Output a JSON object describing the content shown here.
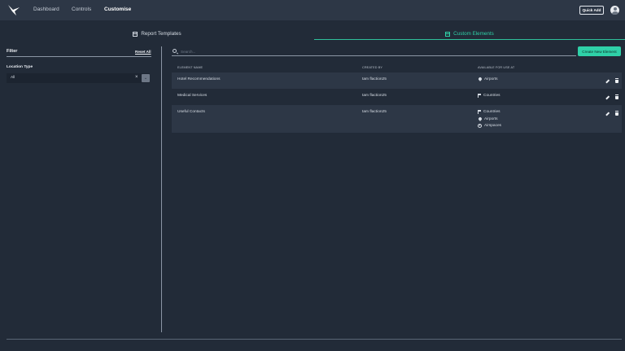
{
  "nav": {
    "items": [
      {
        "label": "Dashboard",
        "active": false
      },
      {
        "label": "Controls",
        "active": false
      },
      {
        "label": "Customise",
        "active": true
      }
    ],
    "quick_add_label": "Quick Add",
    "logo_icon": "bird-logo-icon",
    "avatar_icon": "user-avatar-icon"
  },
  "tabs": {
    "templates_label": "Report Templates",
    "custom_label": "Custom Elements",
    "active": "Custom Elements"
  },
  "filter": {
    "title": "Filter",
    "reset_label": "Reset All",
    "location_type_label": "Location Type",
    "location_type_value": "All"
  },
  "search": {
    "placeholder": "Search..."
  },
  "create_button_label": "Create New Element",
  "table": {
    "headers": {
      "name": "ELEMENT NAME",
      "created_by": "CREATED BY",
      "available": "AVAILABLE FOR USE AT"
    },
    "rows": [
      {
        "name": "Hotel Recommendations",
        "created_by": "tam flaction25",
        "available": [
          {
            "icon": "map-pin-icon",
            "label": "Airports"
          }
        ]
      },
      {
        "name": "Medical Services",
        "created_by": "tam flaction25",
        "available": [
          {
            "icon": "flag-icon",
            "label": "Countries"
          }
        ]
      },
      {
        "name": "Useful Contacts",
        "created_by": "tam flaction25",
        "available": [
          {
            "icon": "flag-icon",
            "label": "Countries"
          },
          {
            "icon": "map-pin-icon",
            "label": "Airports"
          },
          {
            "icon": "airspace-icon",
            "label": "Airspaces"
          }
        ]
      }
    ]
  },
  "colors": {
    "background": "#222b38",
    "navbar": "#2d3746",
    "accent": "#2fd1a8"
  }
}
